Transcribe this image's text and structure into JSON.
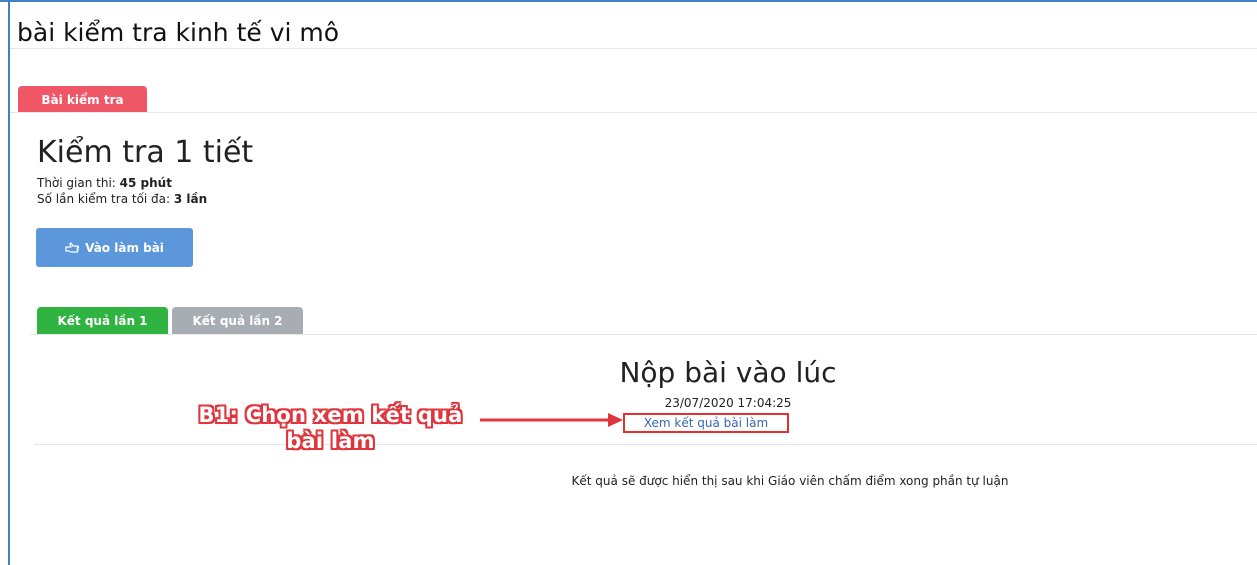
{
  "page_title": "bài kiểm tra kinh tế vi mô",
  "main_tab": "Bài kiểm tra",
  "exam": {
    "title": "Kiểm tra 1 tiết",
    "duration_label": "Thời gian thi: ",
    "duration_value": "45 phút",
    "attempts_label": "Số lần kiểm tra tối đa: ",
    "attempts_value": "3 lần",
    "start_button": "Vào làm bài",
    "start_icon": "hand-pointing-icon"
  },
  "result_tabs": [
    "Kết quả lần 1",
    "Kết quả lần 2"
  ],
  "submission": {
    "title": "Nộp bài vào lúc",
    "time": "23/07/2020 17:04:25",
    "view_link": "Xem kết quả bài làm"
  },
  "annotation": {
    "line1": "B1: Chọn xem kết quả",
    "line2": "bài làm",
    "color": "#e0353d"
  },
  "note": "Kết quả sẽ được hiển thị sau khi Giáo viên chấm điểm xong phần tự luận",
  "colors": {
    "main_tab": "#ef5767",
    "start_button": "#5c97dc",
    "active_result_tab": "#2fb341",
    "inactive_result_tab": "#a8adb4",
    "link": "#3a66b0"
  }
}
